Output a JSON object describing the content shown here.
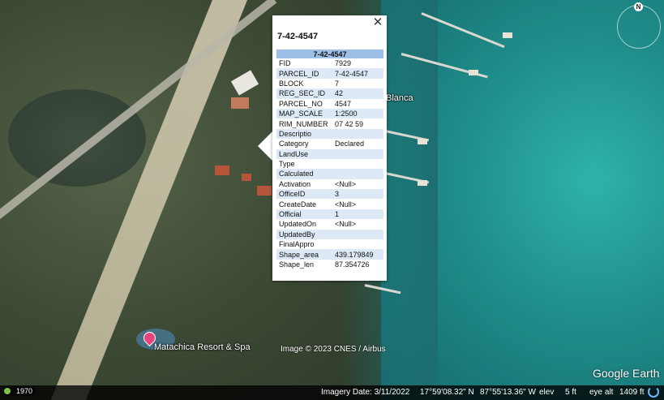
{
  "popup": {
    "title": "7-42-4547",
    "table_header": "7-42-4547",
    "close_glyph": "✕",
    "rows": [
      {
        "key": "FID",
        "value": "7929"
      },
      {
        "key": "PARCEL_ID",
        "value": "7-42-4547"
      },
      {
        "key": "BLOCK",
        "value": "7"
      },
      {
        "key": "REG_SEC_ID",
        "value": "42"
      },
      {
        "key": "PARCEL_NO",
        "value": "4547"
      },
      {
        "key": "MAP_SCALE",
        "value": "1:2500"
      },
      {
        "key": "RIM_NUMBER",
        "value": "07 42 59"
      },
      {
        "key": "Descriptio",
        "value": ""
      },
      {
        "key": "Category",
        "value": "Declared"
      },
      {
        "key": "LandUse",
        "value": ""
      },
      {
        "key": "Type",
        "value": ""
      },
      {
        "key": "Calculated",
        "value": ""
      },
      {
        "key": "Activation",
        "value": "<Null>"
      },
      {
        "key": "OfficeID",
        "value": "3"
      },
      {
        "key": "CreateDate",
        "value": "<Null>"
      },
      {
        "key": "Official",
        "value": "1"
      },
      {
        "key": "UpdatedOn",
        "value": "<Null>"
      },
      {
        "key": "UpdatedBy",
        "value": ""
      },
      {
        "key": "FinalAppro",
        "value": ""
      },
      {
        "key": "Shape_area",
        "value": "439.179849"
      },
      {
        "key": "Shape_len",
        "value": "87.354726"
      }
    ]
  },
  "map": {
    "place_label": "Blanca",
    "resort_label": "Matachica Resort & Spa",
    "attribution": "Image © 2023 CNES / Airbus",
    "logo": "Google Earth",
    "compass_label": "N"
  },
  "status": {
    "year": "1970",
    "imagery_date": "Imagery Date: 3/11/2022",
    "lat": "17°59'08.32\" N",
    "lon": "87°55'13.36\" W",
    "elev_label": "elev",
    "elev_value": "5 ft",
    "eye_alt_label": "eye alt",
    "eye_alt_value": "1409 ft"
  },
  "colors": {
    "popup_header": "#9cc0e6",
    "popup_row_alt": "#dde9f6",
    "pin": "#e7457a"
  }
}
